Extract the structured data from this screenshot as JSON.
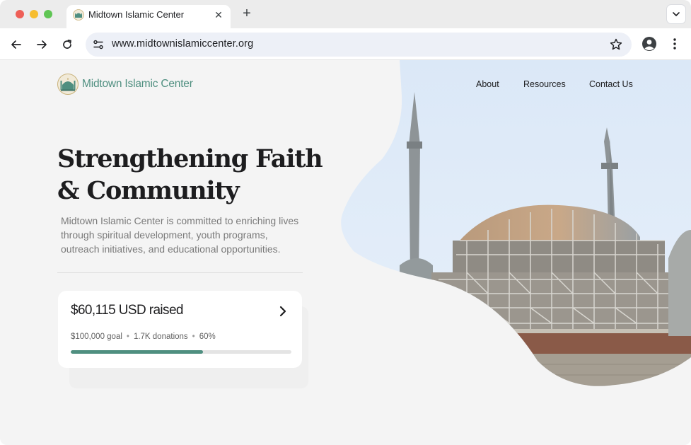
{
  "browser": {
    "tab_title": "Midtown Islamic Center",
    "url": "www.midtownislamiccenter.org"
  },
  "site": {
    "name": "Midtown Islamic Center",
    "nav": [
      {
        "label": "About"
      },
      {
        "label": "Resources"
      },
      {
        "label": "Contact Us"
      }
    ]
  },
  "hero": {
    "headline_line1": "Strengthening Faith",
    "headline_line2": "& Community",
    "description": "Midtown Islamic Center is committed to enriching lives through spiritual development, youth programs, outreach initiatives, and educational opportunities."
  },
  "fundraiser": {
    "raised": "$60,115 USD raised",
    "goal": "$100,000 goal",
    "donations": "1.7K donations",
    "percent_label": "60%",
    "progress": 0.6
  },
  "colors": {
    "brand": "#4f8f80",
    "text": "#1d1d1f",
    "muted": "#7a7a7a"
  }
}
